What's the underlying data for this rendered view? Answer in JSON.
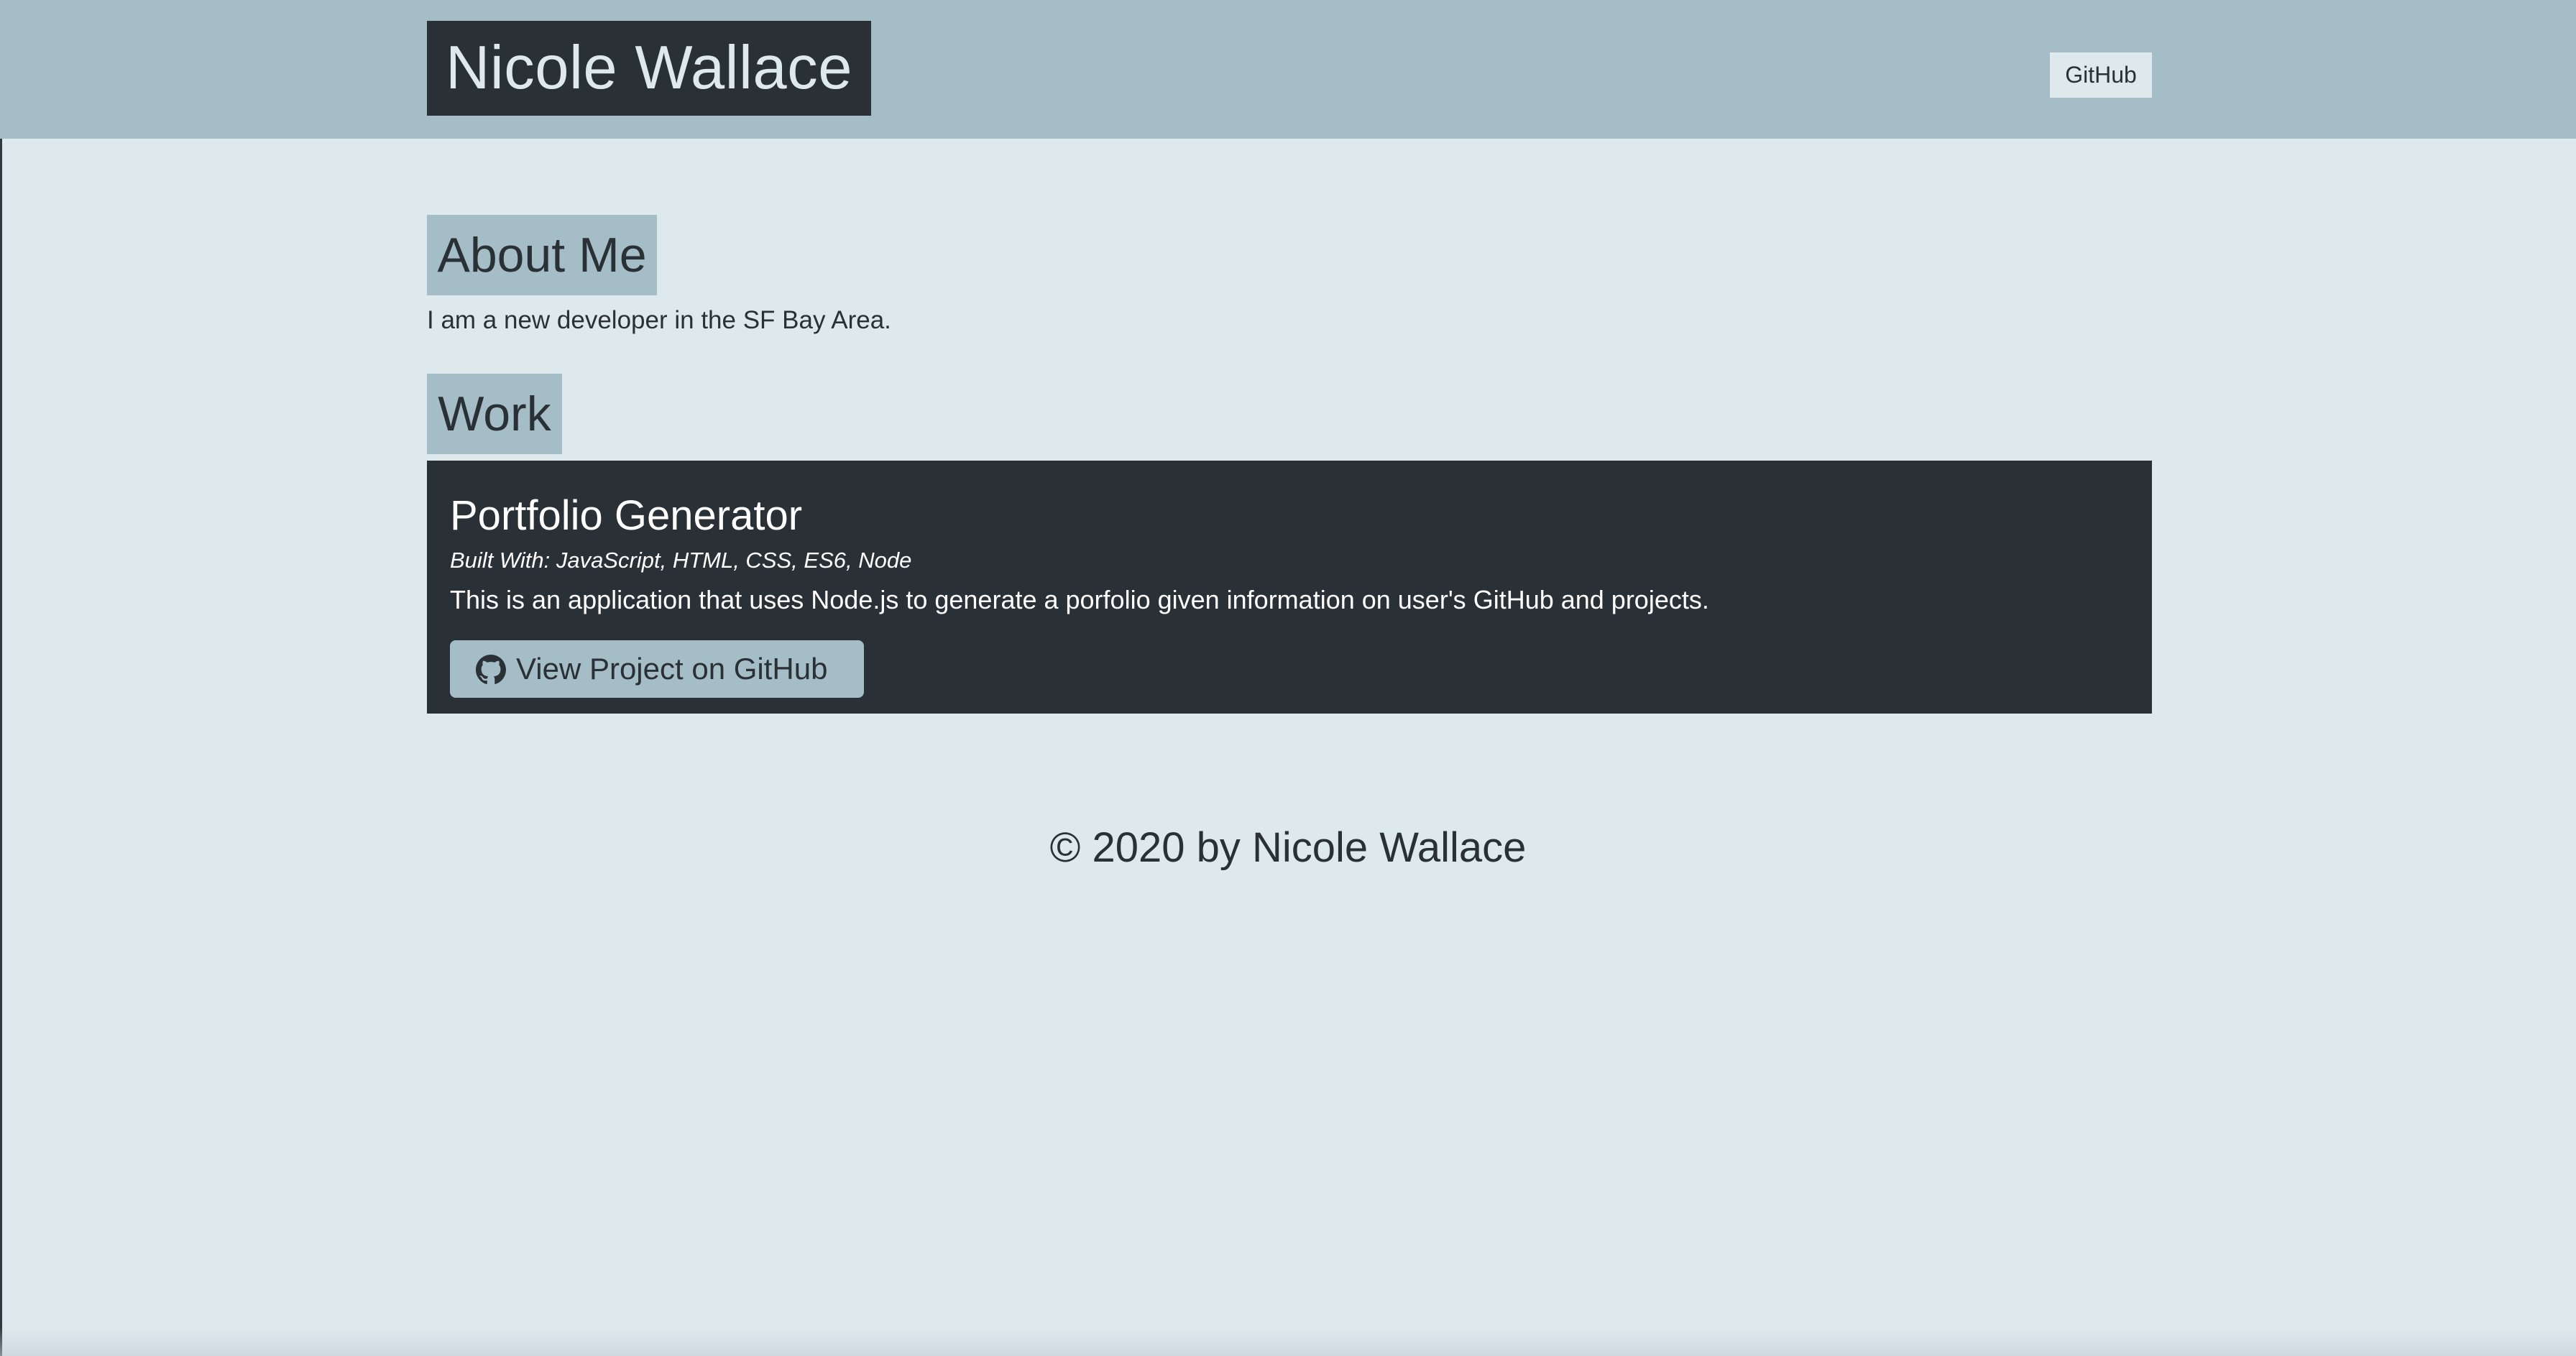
{
  "header": {
    "brand": "Nicole Wallace",
    "nav_link": "GitHub"
  },
  "about": {
    "heading": "About Me",
    "text": "I am a new developer in the SF Bay Area."
  },
  "work": {
    "heading": "Work",
    "projects": [
      {
        "title": "Portfolio Generator",
        "built_with": "Built With: JavaScript, HTML, CSS, ES6, Node",
        "description": "This is an application that uses Node.js to generate a porfolio given information on user's GitHub and projects.",
        "button_label": "View Project on GitHub",
        "button_icon": "github-icon"
      }
    ]
  },
  "footer": {
    "text": "© 2020 by Nicole Wallace"
  },
  "colors": {
    "background": "#dee9ee",
    "header": "#a5bdc6",
    "dark": "#293036"
  }
}
